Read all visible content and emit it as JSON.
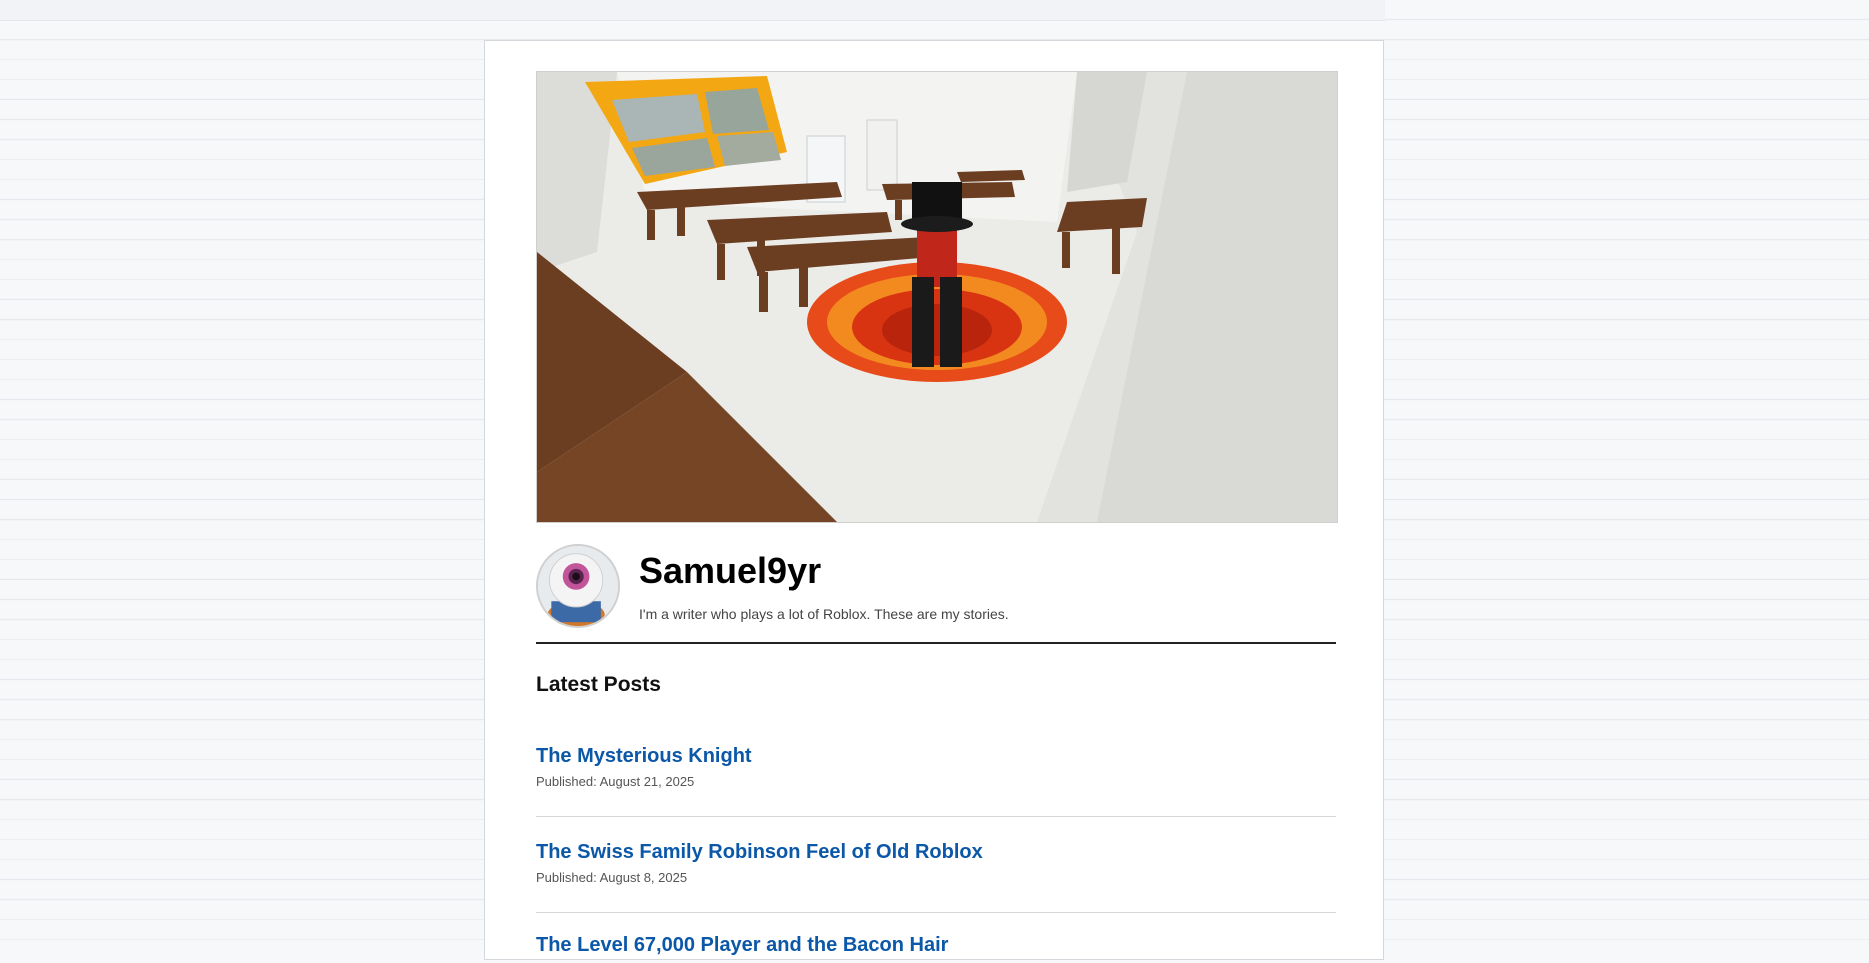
{
  "profile": {
    "name": "Samuel9yr",
    "bio": "I'm a writer who plays a lot of Roblox. These are my stories."
  },
  "latest_posts": {
    "heading": "Latest Posts",
    "items": [
      {
        "title": "The Mysterious Knight",
        "date": "Published: August 21, 2025"
      },
      {
        "title": "The Swiss Family Robinson Feel of Old Roblox",
        "date": "Published: August 8, 2025"
      },
      {
        "title": "The Level 67,000 Player and the Bacon Hair",
        "date": ""
      }
    ]
  },
  "colors": {
    "link": "#0b57a8",
    "page_background": "#f7f8fa",
    "card_background": "#ffffff"
  }
}
